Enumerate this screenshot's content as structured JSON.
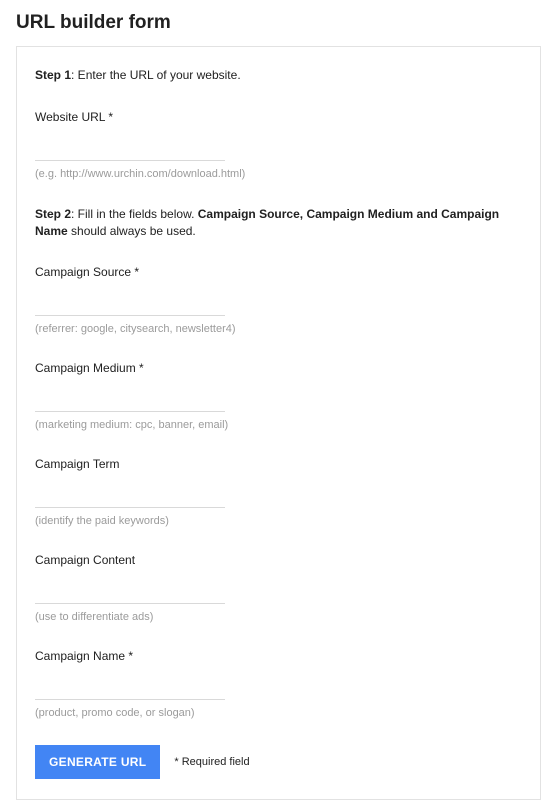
{
  "title": "URL builder form",
  "step1": {
    "bold": "Step 1",
    "text": ": Enter the URL of your website."
  },
  "step2": {
    "bold1": "Step 2",
    "text1": ": Fill in the fields below. ",
    "bold2": "Campaign Source, Campaign Medium and Campaign Name",
    "text2": " should always be used."
  },
  "fields": {
    "website_url": {
      "label": "Website URL *",
      "hint": "(e.g. http://www.urchin.com/download.html)"
    },
    "campaign_source": {
      "label": "Campaign Source *",
      "hint": "(referrer: google, citysearch, newsletter4)"
    },
    "campaign_medium": {
      "label": "Campaign Medium *",
      "hint": "(marketing medium: cpc, banner, email)"
    },
    "campaign_term": {
      "label": "Campaign Term",
      "hint": "(identify the paid keywords)"
    },
    "campaign_content": {
      "label": "Campaign Content",
      "hint": "(use to differentiate ads)"
    },
    "campaign_name": {
      "label": "Campaign Name *",
      "hint": "(product, promo code, or slogan)"
    }
  },
  "footer": {
    "button": "GENERATE URL",
    "required_note": "* Required field"
  }
}
